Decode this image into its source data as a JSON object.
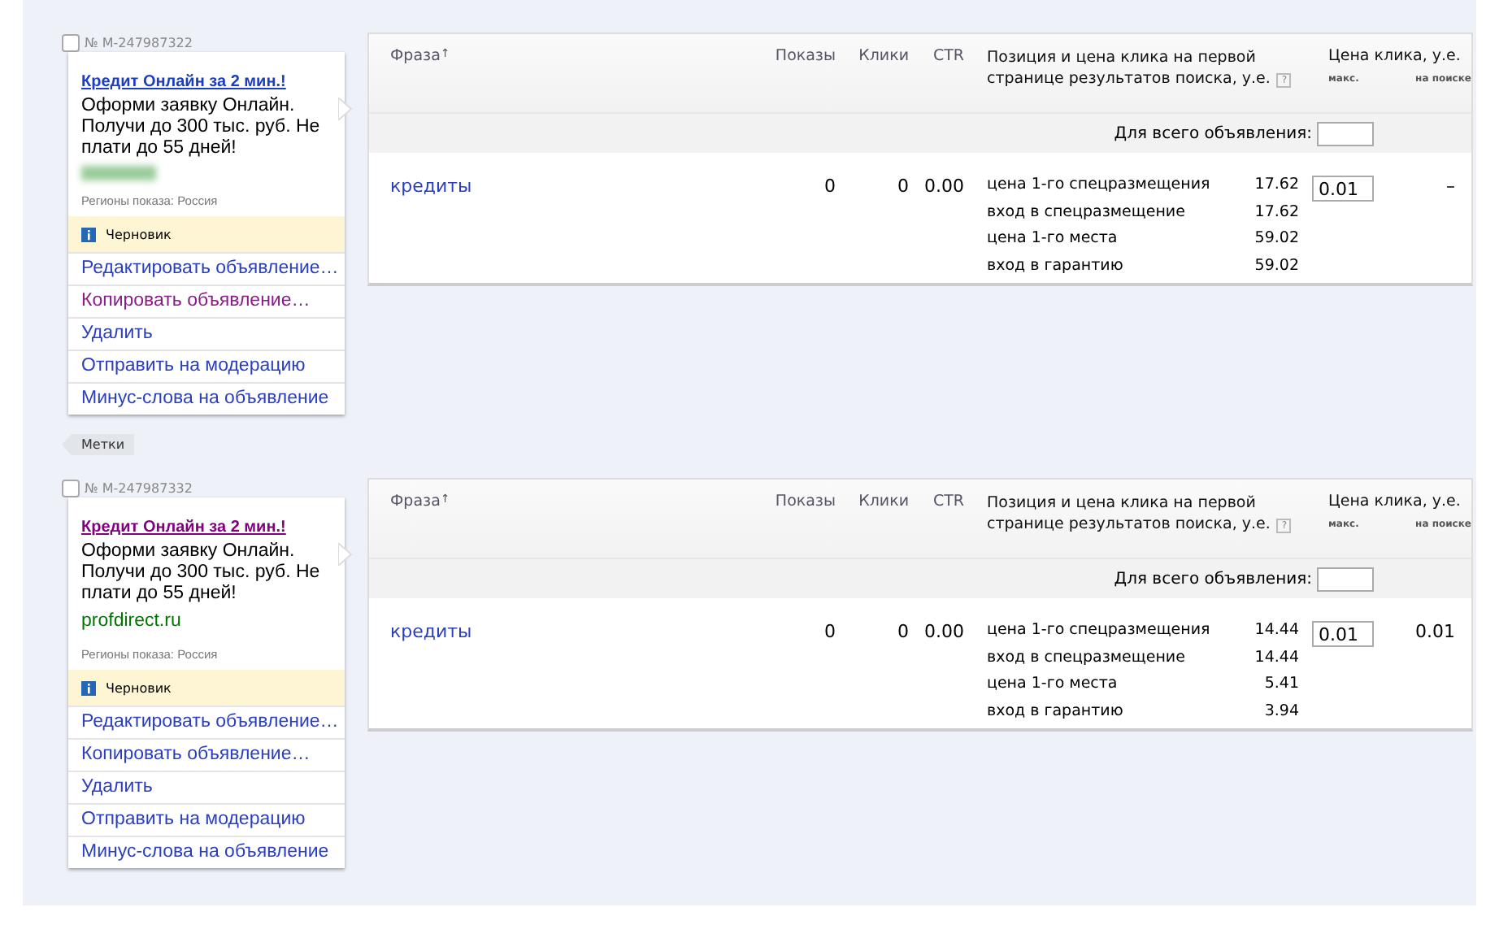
{
  "ads": [
    {
      "number": "№ M-247987322",
      "checked": false,
      "title": "Кредит Онлайн за 2 мин.!",
      "title_visited": false,
      "text": "Оформи заявку Онлайн. Получи до 300 тыс. руб. Не плати до 55 дней!",
      "domain_blurred": true,
      "regions": "Регионы показа: Россия",
      "status": "Черновик",
      "actions": [
        {
          "label": "Редактировать объявление…",
          "visited": false
        },
        {
          "label": "Копировать объявление…",
          "visited": true
        },
        {
          "label": "Удалить",
          "visited": false
        },
        {
          "label": "Отправить на модерацию",
          "visited": false
        },
        {
          "label": "Минус-слова на объявление",
          "visited": false
        }
      ],
      "tags_label": "Метки",
      "table": {
        "columns": {
          "phrase": "Фраза",
          "sort_mark": "↑",
          "shows": "Показы",
          "clicks": "Клики",
          "ctr": "CTR",
          "position": "Позиция и цена клика на первой странице результатов поиска, у.е.",
          "help": "?",
          "price": "Цена клика, у.е.",
          "max": "макс.",
          "on_search": "на поиске"
        },
        "whole_ad_label": "Для всего объявления:",
        "rows": [
          {
            "phrase": "кредиты",
            "shows": "0",
            "clicks": "0",
            "ctr": "0.00",
            "positions": [
              {
                "label": "цена 1-го спецразмещения",
                "value": "17.62"
              },
              {
                "label": "вход в спецразмещение",
                "value": "17.62"
              },
              {
                "label": "цена 1-го места",
                "value": "59.02"
              },
              {
                "label": "вход в гарантию",
                "value": "59.02"
              }
            ],
            "max_price": "0.01",
            "on_search": "–"
          }
        ]
      }
    },
    {
      "number": "№ M-247987332",
      "checked": false,
      "title": "Кредит Онлайн за 2 мин.!",
      "title_visited": true,
      "text": "Оформи заявку Онлайн. Получи до 300 тыс. руб. Не плати до 55 дней!",
      "domain": "profdirect.ru",
      "regions": "Регионы показа: Россия",
      "status": "Черновик",
      "actions": [
        {
          "label": "Редактировать объявление…",
          "visited": false
        },
        {
          "label": "Копировать объявление…",
          "visited": false
        },
        {
          "label": "Удалить",
          "visited": false
        },
        {
          "label": "Отправить на модерацию",
          "visited": false
        },
        {
          "label": "Минус-слова на объявление",
          "visited": false
        }
      ],
      "table": {
        "columns": {
          "phrase": "Фраза",
          "sort_mark": "↑",
          "shows": "Показы",
          "clicks": "Клики",
          "ctr": "CTR",
          "position": "Позиция и цена клика на первой странице результатов поиска, у.е.",
          "help": "?",
          "price": "Цена клика, у.е.",
          "max": "макс.",
          "on_search": "на поиске"
        },
        "whole_ad_label": "Для всего объявления:",
        "rows": [
          {
            "phrase": "кредиты",
            "shows": "0",
            "clicks": "0",
            "ctr": "0.00",
            "positions": [
              {
                "label": "цена 1-го спецразмещения",
                "value": "14.44"
              },
              {
                "label": "вход в спецразмещение",
                "value": "14.44"
              },
              {
                "label": "цена 1-го места",
                "value": "5.41"
              },
              {
                "label": "вход в гарантию",
                "value": "3.94"
              }
            ],
            "max_price": "0.01",
            "on_search": "0.01"
          }
        ]
      }
    }
  ]
}
